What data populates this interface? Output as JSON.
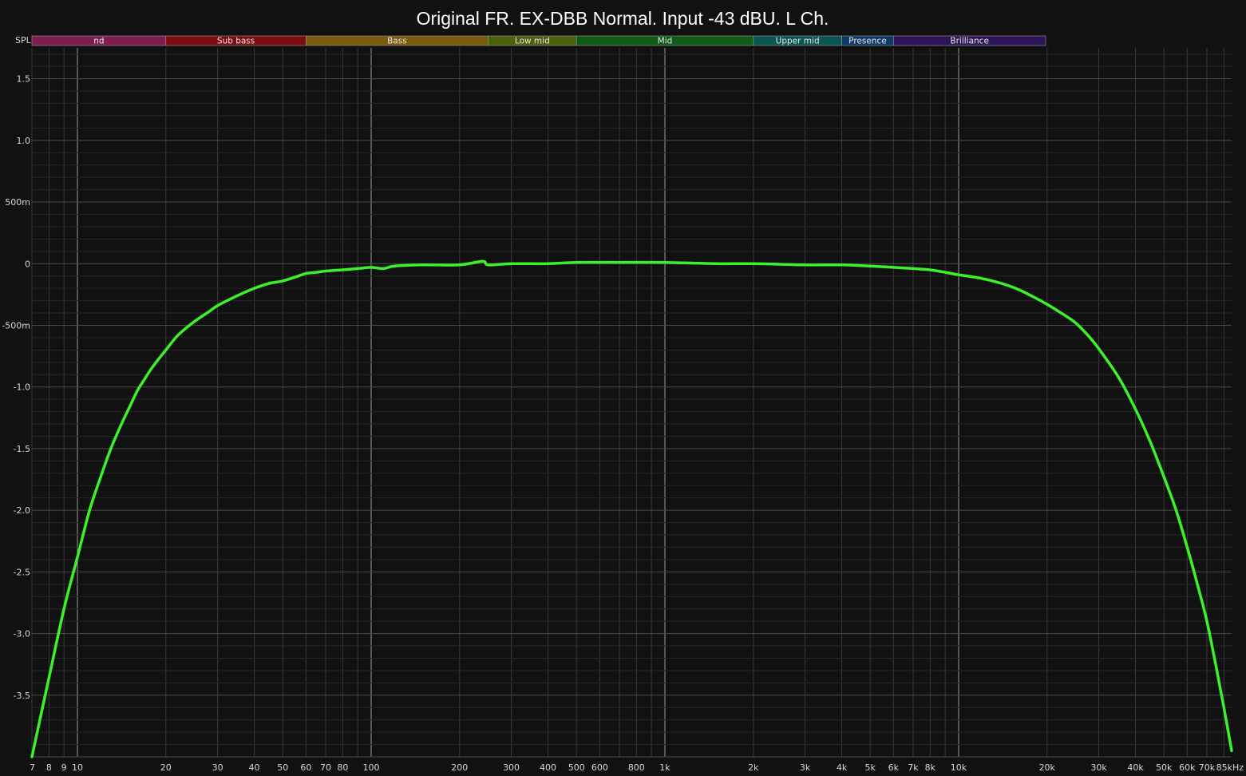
{
  "chart_data": {
    "type": "line",
    "title": "Original FR. EX-DBB Normal. Input -43 dBU. L Ch.",
    "ylabel": "SPL",
    "xscale": "log",
    "xlim": [
      7,
      85000
    ],
    "ylim": [
      -4.0,
      1.75
    ],
    "grid": true,
    "bands": [
      {
        "label": "nd",
        "from": 7,
        "to": 20,
        "color": "#7d1e4f"
      },
      {
        "label": "Sub bass",
        "from": 20,
        "to": 60,
        "color": "#7d0d0d"
      },
      {
        "label": "Bass",
        "from": 60,
        "to": 250,
        "color": "#7a5a0c"
      },
      {
        "label": "Low mid",
        "from": 250,
        "to": 500,
        "color": "#4c5f0c"
      },
      {
        "label": "Mid",
        "from": 500,
        "to": 2000,
        "color": "#0f5a16"
      },
      {
        "label": "Upper mid",
        "from": 2000,
        "to": 4000,
        "color": "#0b5650"
      },
      {
        "label": "Presence",
        "from": 4000,
        "to": 6000,
        "color": "#0e3a6a"
      },
      {
        "label": "Brilliance",
        "from": 6000,
        "to": 20000,
        "color": "#2d1558"
      }
    ],
    "y_ticks": [
      {
        "value": 1.5,
        "label": "1.5"
      },
      {
        "value": 1.0,
        "label": "1.0"
      },
      {
        "value": 0.5,
        "label": "500m"
      },
      {
        "value": 0,
        "label": "0"
      },
      {
        "value": -0.5,
        "label": "-500m"
      },
      {
        "value": -1.0,
        "label": "-1.0"
      },
      {
        "value": -1.5,
        "label": "-1.5"
      },
      {
        "value": -2.0,
        "label": "-2.0"
      },
      {
        "value": -2.5,
        "label": "-2.5"
      },
      {
        "value": -3.0,
        "label": "-3.0"
      },
      {
        "value": -3.5,
        "label": "-3.5"
      }
    ],
    "x_ticks": [
      {
        "value": 7,
        "label": "7"
      },
      {
        "value": 8,
        "label": "8"
      },
      {
        "value": 9,
        "label": "9"
      },
      {
        "value": 10,
        "label": "10"
      },
      {
        "value": 20,
        "label": "20"
      },
      {
        "value": 30,
        "label": "30"
      },
      {
        "value": 40,
        "label": "40"
      },
      {
        "value": 50,
        "label": "50"
      },
      {
        "value": 60,
        "label": "60"
      },
      {
        "value": 70,
        "label": "70"
      },
      {
        "value": 80,
        "label": "80"
      },
      {
        "value": 100,
        "label": "100"
      },
      {
        "value": 200,
        "label": "200"
      },
      {
        "value": 300,
        "label": "300"
      },
      {
        "value": 400,
        "label": "400"
      },
      {
        "value": 500,
        "label": "500"
      },
      {
        "value": 600,
        "label": "600"
      },
      {
        "value": 800,
        "label": "800"
      },
      {
        "value": 1000,
        "label": "1k"
      },
      {
        "value": 2000,
        "label": "2k"
      },
      {
        "value": 3000,
        "label": "3k"
      },
      {
        "value": 4000,
        "label": "4k"
      },
      {
        "value": 5000,
        "label": "5k"
      },
      {
        "value": 6000,
        "label": "6k"
      },
      {
        "value": 7000,
        "label": "7k"
      },
      {
        "value": 8000,
        "label": "8k"
      },
      {
        "value": 10000,
        "label": "10k"
      },
      {
        "value": 20000,
        "label": "20k"
      },
      {
        "value": 30000,
        "label": "30k"
      },
      {
        "value": 40000,
        "label": "40k"
      },
      {
        "value": 50000,
        "label": "50k"
      },
      {
        "value": 60000,
        "label": "60k"
      },
      {
        "value": 70000,
        "label": "70k"
      },
      {
        "value": 85000,
        "label": "85kHz"
      }
    ],
    "series": [
      {
        "color": "#3cf02a",
        "x": [
          7,
          8,
          9,
          10,
          11,
          12,
          13,
          14,
          15,
          16,
          17,
          18,
          20,
          22,
          25,
          28,
          30,
          35,
          40,
          45,
          50,
          55,
          60,
          65,
          70,
          80,
          90,
          100,
          110,
          120,
          150,
          200,
          240,
          250,
          300,
          400,
          500,
          700,
          1000,
          1500,
          2000,
          3000,
          4000,
          5000,
          6000,
          7000,
          8000,
          9000,
          10000,
          12000,
          14000,
          16000,
          18000,
          20000,
          22000,
          25000,
          28000,
          30000,
          35000,
          40000,
          45000,
          50000,
          55000,
          60000,
          65000,
          70000,
          75000,
          80000,
          85000
        ],
        "y": [
          -4.0,
          -3.36,
          -2.8,
          -2.38,
          -2.0,
          -1.73,
          -1.5,
          -1.32,
          -1.17,
          -1.03,
          -0.93,
          -0.84,
          -0.7,
          -0.58,
          -0.47,
          -0.39,
          -0.34,
          -0.26,
          -0.2,
          -0.16,
          -0.14,
          -0.11,
          -0.08,
          -0.07,
          -0.06,
          -0.05,
          -0.04,
          -0.03,
          -0.04,
          -0.02,
          -0.01,
          -0.01,
          0.02,
          -0.01,
          0.0,
          0.0,
          0.01,
          0.01,
          0.01,
          0.0,
          0.0,
          -0.01,
          -0.01,
          -0.02,
          -0.03,
          -0.04,
          -0.05,
          -0.07,
          -0.09,
          -0.12,
          -0.16,
          -0.21,
          -0.27,
          -0.33,
          -0.39,
          -0.48,
          -0.6,
          -0.69,
          -0.92,
          -1.18,
          -1.45,
          -1.73,
          -2.0,
          -2.3,
          -2.6,
          -2.9,
          -3.25,
          -3.6,
          -3.95
        ]
      }
    ]
  }
}
